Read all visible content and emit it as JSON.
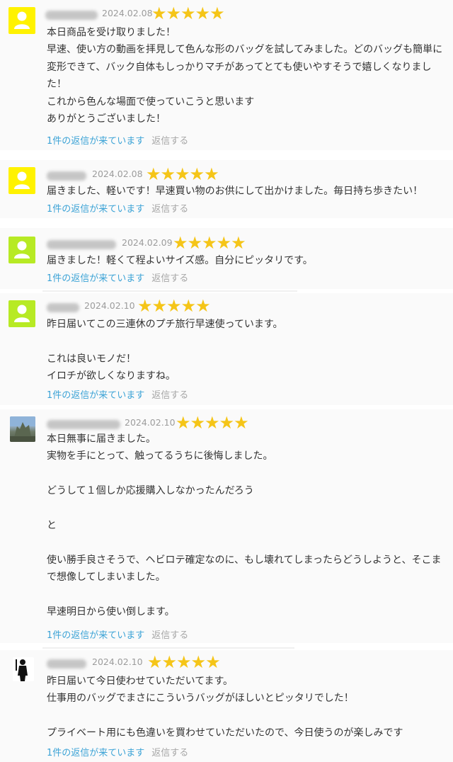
{
  "colors": {
    "star": "#f5c518",
    "link": "#3ca3d6",
    "avatar_yellow": "#fff200",
    "avatar_lime": "#b7ea24"
  },
  "icons": {
    "default_avatar": "user-silhouette-icon",
    "rating": "star-icon"
  },
  "reviews": [
    {
      "user_name": "",
      "date": "2024.02.08",
      "rating": 5,
      "stars": "★★★★★",
      "avatar": "yellow",
      "lines": [
        "本日商品を受け取りました！",
        "早速、使い方の動画を拝見して色んな形のバッグを試してみました。どのバッグも簡単に変形できて、バック自体もしっかりマチがあってとても使いやすそうで嬉しくなりました！",
        "これから色んな場面で使っていこうと思います",
        "ありがとうございました！"
      ],
      "reply_count": "1件の返信が来ています",
      "reply_label": "返信する"
    },
    {
      "user_name": "",
      "date": "2024.02.08",
      "rating": 5,
      "stars": "★★★★★",
      "avatar": "yellow",
      "lines": [
        "届きました、軽いです！早速買い物のお供にして出かけました。毎日持ち歩きたい！"
      ],
      "reply_count": "1件の返信が来ています",
      "reply_label": "返信する"
    },
    {
      "user_name": "",
      "date": "2024.02.09",
      "rating": 5,
      "stars": "★★★★★",
      "avatar": "lime",
      "lines": [
        "届きました！軽くて程よいサイズ感。自分にピッタリです。"
      ],
      "reply_count": "1件の返信が来ています",
      "reply_label": "返信する"
    },
    {
      "user_name": "",
      "date": "2024.02.10",
      "rating": 5,
      "stars": "★★★★★",
      "avatar": "lime",
      "lines": [
        "昨日届いてこの三連休のプチ旅行早速使っています。",
        "",
        "これは良いモノだ！",
        "イロチが欲しくなりますね。"
      ],
      "reply_count": "1件の返信が来ています",
      "reply_label": "返信する"
    },
    {
      "user_name": "",
      "date": "2024.02.10",
      "rating": 5,
      "stars": "★★★★★",
      "avatar": "photo",
      "lines": [
        "本日無事に届きました。",
        "実物を手にとって、触ってるうちに後悔しました。",
        "",
        "どうして１個しか応援購入しなかったんだろう",
        "",
        "と",
        "",
        "使い勝手良さそうで、ヘビロテ確定なのに、もし壊れてしまったらどうしようと、そこまで想像してしまいました。",
        "",
        "早速明日から使い倒します。"
      ],
      "reply_count": "1件の返信が来ています",
      "reply_label": "返信する"
    },
    {
      "user_name": "",
      "date": "2024.02.10",
      "rating": 5,
      "stars": "★★★★★",
      "avatar": "silhouette",
      "lines": [
        "昨日届いて今日使わせていただいてます。",
        "仕事用のバッグでまさにこういうバッグがほしいとピッタリでした！",
        "",
        "プライベート用にも色違いを買わせていただいたので、今日使うのが楽しみです"
      ],
      "reply_count": "1件の返信が来ています",
      "reply_label": "返信する"
    }
  ]
}
